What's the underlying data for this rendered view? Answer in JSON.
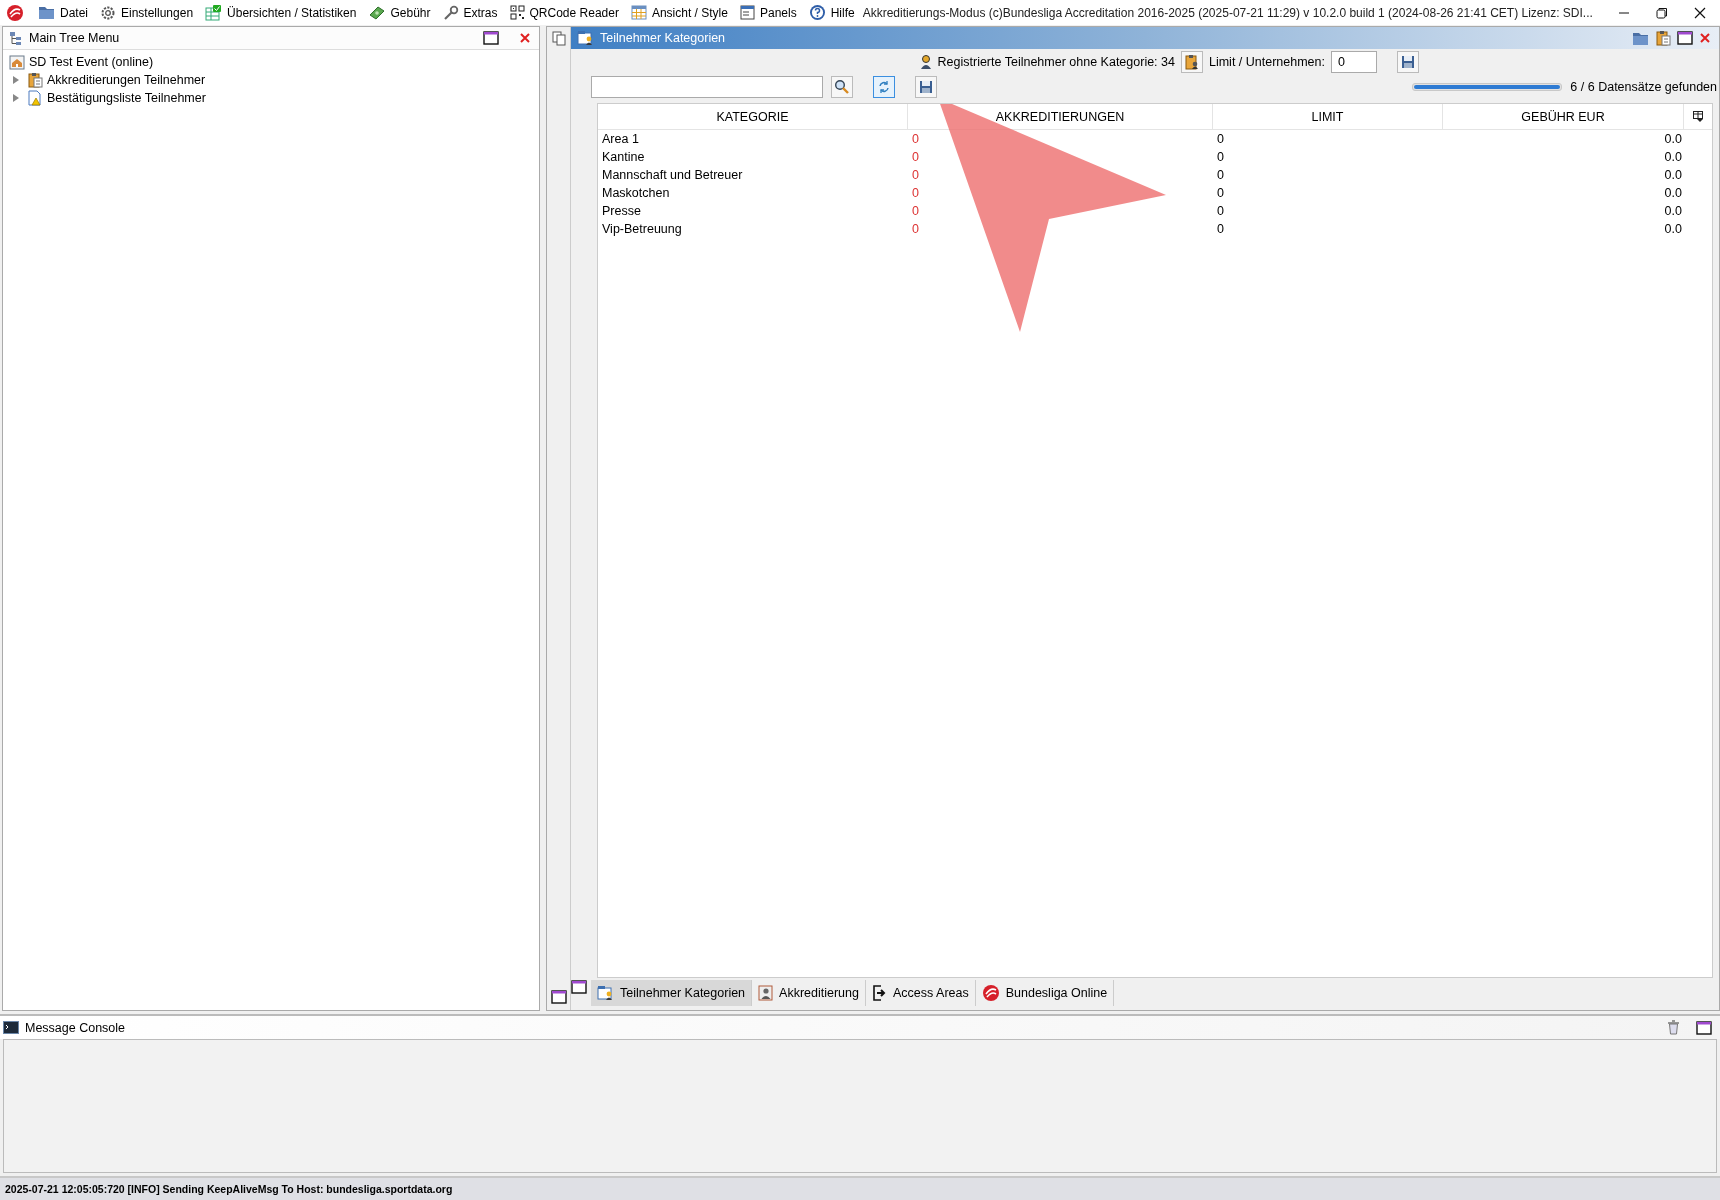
{
  "menu": {
    "items": [
      {
        "label": "Datei"
      },
      {
        "label": "Einstellungen"
      },
      {
        "label": "Übersichten / Statistiken"
      },
      {
        "label": "Gebühr"
      },
      {
        "label": "Extras"
      },
      {
        "label": "QRCode Reader"
      },
      {
        "label": "Ansicht / Style"
      },
      {
        "label": "Panels"
      },
      {
        "label": "Hilfe"
      }
    ]
  },
  "window": {
    "title": "Akkreditierungs-Modus (c)Bundesliga Accreditation 2016-2025 (2025-07-21 11:29) v 10.2.0 build 1 (2024-08-26 21:41 CET) Lizenz: SDI..."
  },
  "tree_panel": {
    "title": "Main Tree Menu",
    "items": [
      {
        "label": "SD Test Event (online)",
        "children": [
          {
            "label": "Akkreditierungen Teilnehmer",
            "expanded": false
          },
          {
            "label": "Bestätigungsliste Teilnehmer",
            "expanded": false
          }
        ]
      }
    ]
  },
  "content": {
    "title": "Teilnehmer Kategorien",
    "info": "Registrierte Teilnehmer ohne Kategorie: 34",
    "limit_label": "Limit / Unternehmen:",
    "limit_value": "0",
    "progress": {
      "level": 1
    },
    "result_count": "6 / 6 Datensätze gefunden",
    "table": {
      "columns": [
        "KATEGORIE",
        "AKKREDITIERUNGEN",
        "LIMIT",
        "GEBÜHR EUR"
      ],
      "rows": [
        [
          "Area 1",
          "0",
          "0",
          "0.0"
        ],
        [
          "Kantine",
          "0",
          "0",
          "0.0"
        ],
        [
          "Mannschaft und Betreuer",
          "0",
          "0",
          "0.0"
        ],
        [
          "Maskotchen",
          "0",
          "0",
          "0.0"
        ],
        [
          "Presse",
          "0",
          "0",
          "0.0"
        ],
        [
          "Vip-Betreuung",
          "0",
          "0",
          "0.0"
        ]
      ]
    },
    "tabs": [
      {
        "label": "Teilnehmer Kategorien",
        "selected": true
      },
      {
        "label": "Akkreditierung",
        "selected": false
      },
      {
        "label": "Access Areas",
        "selected": false
      },
      {
        "label": "Bundesliga Online",
        "selected": false
      }
    ]
  },
  "console": {
    "title": "Message Console"
  },
  "status_bar": "2025-07-21 12:05:05:720 [INFO] Sending KeepAliveMsg To Host: bundesliga.sportdata.org"
}
